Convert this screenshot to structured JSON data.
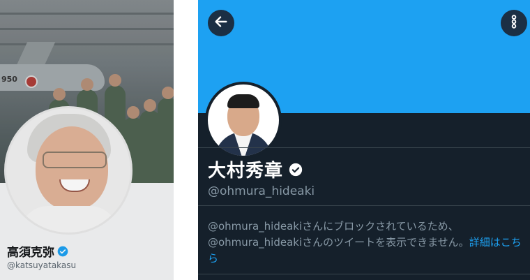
{
  "left_profile": {
    "name": "高須克弥",
    "handle": "@katsuyatakasu",
    "banner_text": "950",
    "verified_badge_color": "#1da1f2"
  },
  "right_profile": {
    "name": "大村秀章",
    "handle": "@ohmura_hideaki",
    "blocked_message": "@ohmura_hideakiさんにブロックされているため、@ohmura_hideakiさんのツイートを表示できません。",
    "details_link": "詳細はこちら",
    "banner_color": "#1da1f2",
    "background_color": "#15202b",
    "back_icon": "arrow-left-icon",
    "more_icon": "more-vertical-icon"
  }
}
